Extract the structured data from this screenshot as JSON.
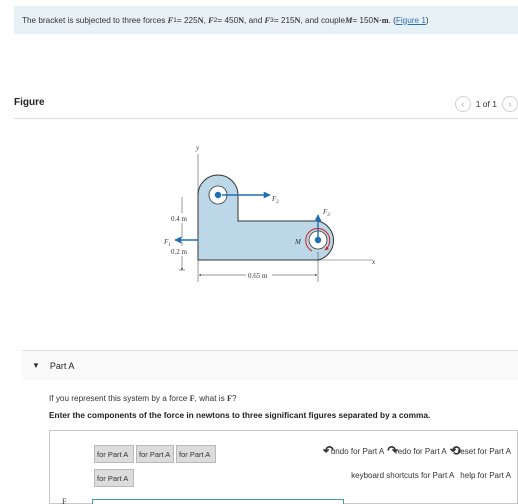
{
  "problem": {
    "prefix": "The bracket is subjected to three forces",
    "f1_sym": "F",
    "f1_sub": "1",
    "f1_val": " = 225 ",
    "unit_n": "N",
    "f2_sym": "F",
    "f2_sub": "2",
    "f2_val": " = 450 ",
    "f3_sym": "F",
    "f3_sub": "3",
    "f3_val": " = 215 ",
    "couple_text": ", and couple ",
    "m_sym": "M",
    "m_val": " = 150 ",
    "unit_nm": "N·m",
    "figure_link": "Figure 1"
  },
  "figure": {
    "title": "Figure",
    "pager": "1 of 1",
    "prev_icon": "chevron-left-icon",
    "next_icon": "chevron-right-icon",
    "labels": {
      "y": "y",
      "x": "x",
      "f1": "F",
      "f1_sub": "1",
      "f2": "F",
      "f2_sub": "2",
      "f3": "F",
      "f3_sub": "3",
      "m": "M",
      "d04": "0.4 m",
      "d02": "0.2 m",
      "d065": "0.65 m"
    }
  },
  "part": {
    "label": "Part A",
    "caret_icon": "caret-down-icon"
  },
  "question": {
    "text_a": "If you represent this system by a force ",
    "f": "F",
    "text_b": ", what is ",
    "f2": "F",
    "text_c": "?"
  },
  "instruction": "Enter the components of the force in newtons to three significant figures separated by a comma.",
  "toolbar": {
    "btn1": "for Part A",
    "btn2": "for Part A",
    "btn3": "for Part A",
    "btn4": "for Part A",
    "undo": "undo for Part A",
    "redo": "redo for Part A",
    "reset": "reset for Part A",
    "keyboard": "keyboard shortcuts for Part A",
    "help": "help for Part A"
  },
  "answer": {
    "label": "F",
    "value": ""
  },
  "colors": {
    "accent_blue": "#1f6fb5",
    "link": "#2a6ebb",
    "moment_red": "#cc2222",
    "bracket_fill": "#bcd8e8"
  }
}
